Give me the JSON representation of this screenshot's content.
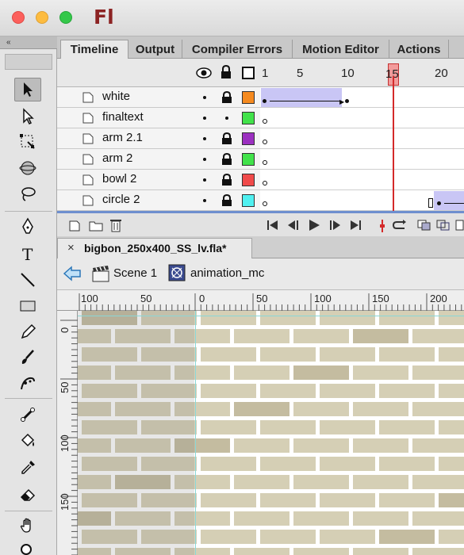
{
  "app": {
    "logo": "Fl"
  },
  "panel_tabs": [
    {
      "label": "Timeline",
      "active": true
    },
    {
      "label": "Output",
      "active": false
    },
    {
      "label": "Compiler Errors",
      "active": false
    },
    {
      "label": "Motion Editor",
      "active": false
    },
    {
      "label": "Actions",
      "active": false
    }
  ],
  "timeline": {
    "frame_numbers": [
      "1",
      "5",
      "10",
      "15",
      "20"
    ],
    "current_frame": "15",
    "layers": [
      {
        "name": "white",
        "color": "#f58a1f"
      },
      {
        "name": "finaltext",
        "color": "#41e24a"
      },
      {
        "name": "arm 2.1",
        "color": "#9b2fc0"
      },
      {
        "name": "arm 2",
        "color": "#41e24a"
      },
      {
        "name": "bowl 2",
        "color": "#f04a4a"
      },
      {
        "name": "circle 2",
        "color": "#4ff0f0"
      }
    ]
  },
  "document": {
    "tab_close": "×",
    "tab_title": "bigbon_250x400_SS_lv.fla*",
    "breadcrumb": [
      {
        "label": "Scene 1",
        "icon": "clapperboard-icon"
      },
      {
        "label": "animation_mc",
        "icon": "movie-clip-icon"
      }
    ]
  },
  "rulers": {
    "top_labels": [
      "100",
      "50",
      "0",
      "50",
      "100",
      "150",
      "200"
    ],
    "left_labels": [
      "0",
      "50",
      "100",
      "150"
    ]
  },
  "colors": {
    "brick": "#d5cfb5",
    "brick_shade": "#c4bca0",
    "mortar": "#ffffff",
    "selection": "#c9c6f5",
    "playhead": "#d42a2a"
  }
}
